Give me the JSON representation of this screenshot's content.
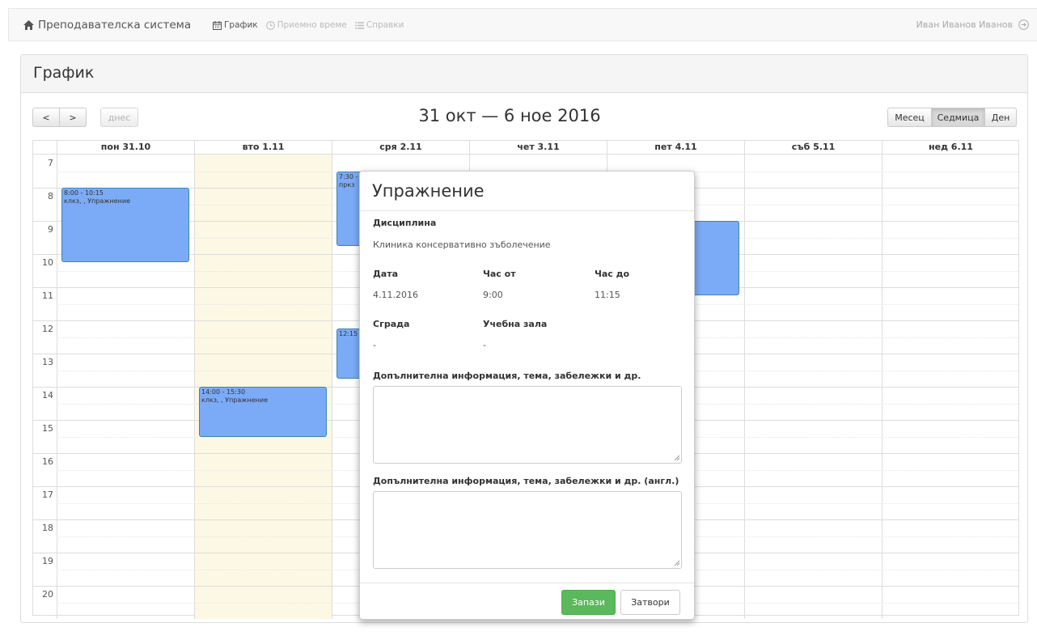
{
  "nav": {
    "brand": "Преподавателска система",
    "links": [
      {
        "label": "График"
      },
      {
        "label": "Приемно време"
      },
      {
        "label": "Справки"
      }
    ],
    "user": "Иван Иванов Иванов"
  },
  "panel": {
    "title": "График"
  },
  "toolbar": {
    "prev": "<",
    "next": ">",
    "today": "днес",
    "range_title": "31 окт — 6 ное 2016",
    "views": [
      "Месец",
      "Седмица",
      "Ден"
    ],
    "active_view": "Седмица"
  },
  "calendar": {
    "days": [
      "пон 31.10",
      "вто 1.11",
      "сря 2.11",
      "чет 3.11",
      "пет 4.11",
      "съб 5.11",
      "нед 6.11"
    ],
    "hours": [
      "7",
      "8",
      "9",
      "10",
      "11",
      "12",
      "13",
      "14",
      "15",
      "16",
      "17",
      "18",
      "19",
      "20"
    ],
    "today_day": "вто 1.11",
    "events": [
      {
        "day": "пон 31.10",
        "start": "8:00",
        "end": "10:15",
        "time": "8:00 - 10:15",
        "title": "клкз, , Упражнение"
      },
      {
        "day": "вто 1.11",
        "start": "14:00",
        "end": "15:30",
        "time": "14:00 - 15:30",
        "title": "клкз, , Упражнение"
      },
      {
        "day": "сря 2.11",
        "start": "7:30",
        "end": "9:45",
        "time": "7:30 -",
        "title": "пркз"
      },
      {
        "day": "сря 2.11",
        "start": "12:15",
        "end": "13:45",
        "time": "12:15 -",
        "title": ""
      },
      {
        "day": "пет 4.11",
        "start": "9:00",
        "end": "11:15",
        "time": "",
        "title": ""
      }
    ]
  },
  "modal": {
    "title": "Упражнение",
    "discipline_label": "Дисциплина",
    "discipline_value": "Клиника консервативно зъболечение",
    "date_label": "Дата",
    "date_value": "4.11.2016",
    "from_label": "Час от",
    "from_value": "9:00",
    "to_label": "Час до",
    "to_value": "11:15",
    "building_label": "Сграда",
    "building_value": "-",
    "room_label": "Учебна зала",
    "room_value": "-",
    "info_label": "Допълнителна информация, тема, забележки и др.",
    "info_value": "",
    "info_en_label": "Допълнителна информация, тема, забележки и др. (англ.)",
    "info_en_value": "",
    "save_label": "Запази",
    "close_label": "Затвори",
    "save_color": "#5cb85c"
  },
  "colors": {
    "event": "#7baaf7",
    "today_bg": "#fcf8e3"
  }
}
